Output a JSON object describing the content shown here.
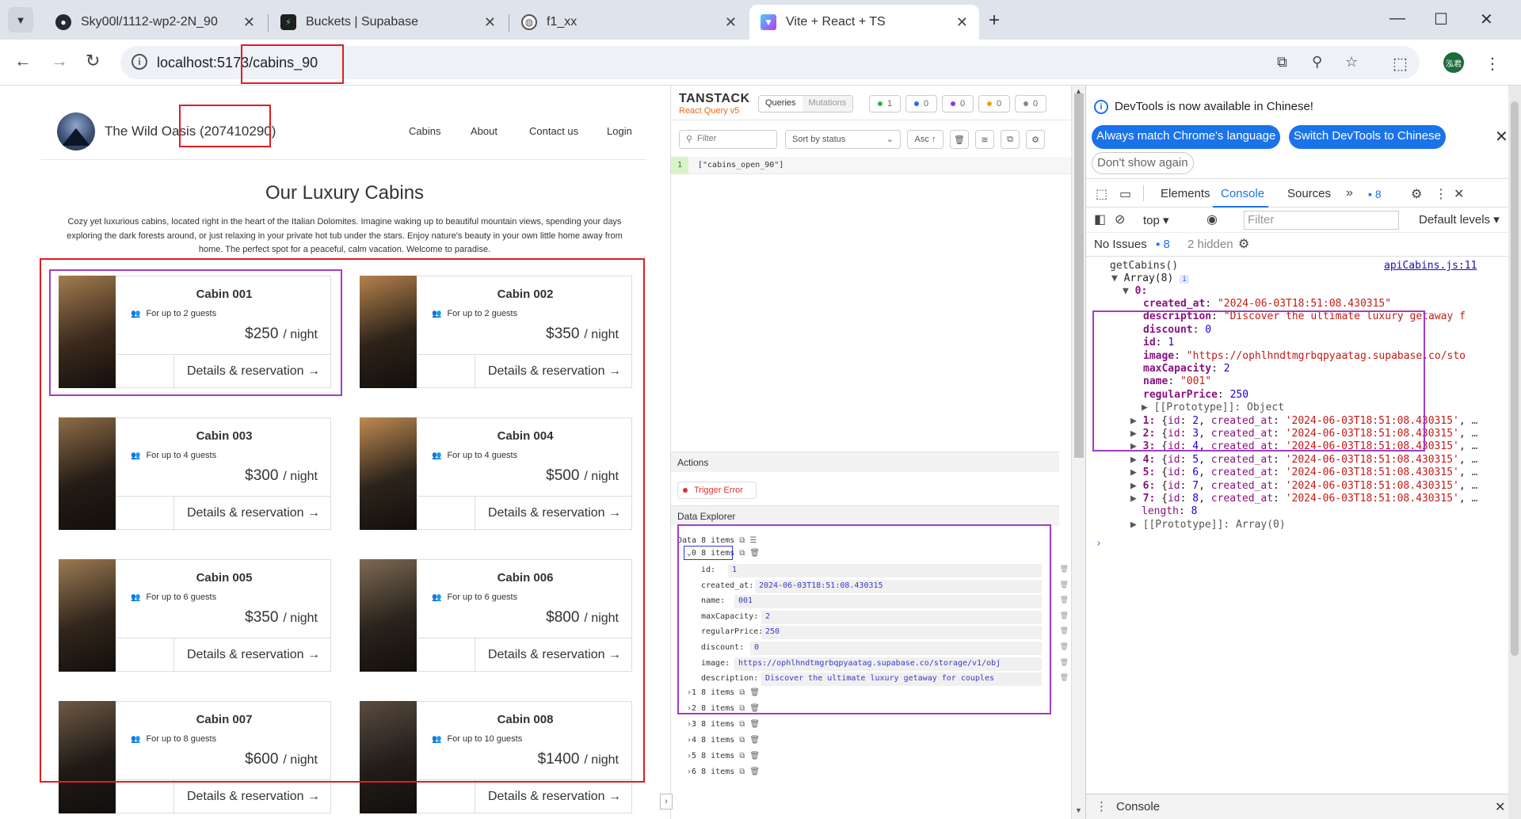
{
  "browser": {
    "tabs": [
      {
        "title": "Sky00l/1112-wp2-2N_90",
        "icon": "github-icon"
      },
      {
        "title": "Buckets | Supabase",
        "icon": "supabase-icon"
      },
      {
        "title": "f1_xx",
        "icon": "globe-icon"
      },
      {
        "title": "Vite + React + TS",
        "icon": "vite-icon"
      }
    ],
    "url": "localhost:5173/cabins_90",
    "avatar_text": "泓君"
  },
  "site": {
    "name": "The Wild Oasis (207410290)",
    "nav": [
      "Cabins",
      "About",
      "Contact us",
      "Login"
    ],
    "title": "Our Luxury Cabins",
    "description": "Cozy yet luxurious cabins, located right in the heart of the Italian Dolomites. Imagine waking up to beautiful mountain views, spending your days exploring the dark forests around, or just relaxing in your private hot tub under the stars. Enjoy nature's beauty in your own little home away from home. The perfect spot for a peaceful, calm vacation. Welcome to paradise.",
    "details_label": "Details & reservation →",
    "per_night": "/ night",
    "cabins": [
      {
        "name": "Cabin 001",
        "guests": "For up to 2 guests",
        "price": "$250"
      },
      {
        "name": "Cabin 002",
        "guests": "For up to 2 guests",
        "price": "$350"
      },
      {
        "name": "Cabin 003",
        "guests": "For up to 4 guests",
        "price": "$300"
      },
      {
        "name": "Cabin 004",
        "guests": "For up to 4 guests",
        "price": "$500"
      },
      {
        "name": "Cabin 005",
        "guests": "For up to 6 guests",
        "price": "$350"
      },
      {
        "name": "Cabin 006",
        "guests": "For up to 6 guests",
        "price": "$800"
      },
      {
        "name": "Cabin 007",
        "guests": "For up to 8 guests",
        "price": "$600"
      },
      {
        "name": "Cabin 008",
        "guests": "For up to 10 guests",
        "price": "$1400"
      }
    ]
  },
  "react_query": {
    "brand": "TANSTACK",
    "sub": "React Query v5",
    "tabs": [
      "Queries",
      "Mutations"
    ],
    "badges": [
      {
        "count": "1",
        "color": "#2fb344"
      },
      {
        "count": "0",
        "color": "#1a73e8"
      },
      {
        "count": "0",
        "color": "#7c3aed"
      },
      {
        "count": "0",
        "color": "#f59f00"
      },
      {
        "count": "0",
        "color": "#888888"
      }
    ],
    "filter_placeholder": "Filter",
    "sort": "Sort by status",
    "order": "Asc ↑",
    "query_count": "1",
    "query_key": "[\"cabins_open_90\"]",
    "actions_label": "Actions",
    "trigger_error": "Trigger Error",
    "explorer_label": "Data Explorer",
    "data_root": "Data",
    "data_root_count": "8 items",
    "items": [
      {
        "label": "0",
        "count": "8 items"
      },
      {
        "label": "1",
        "count": "8 items"
      },
      {
        "label": "2",
        "count": "8 items"
      },
      {
        "label": "3",
        "count": "8 items"
      },
      {
        "label": "4",
        "count": "8 items"
      },
      {
        "label": "5",
        "count": "8 items"
      },
      {
        "label": "6",
        "count": "8 items"
      }
    ],
    "fields": [
      {
        "key": "id:",
        "value": "1"
      },
      {
        "key": "created_at:",
        "value": "2024-06-03T18:51:08.430315"
      },
      {
        "key": "name:",
        "value": "001"
      },
      {
        "key": "maxCapacity:",
        "value": "2"
      },
      {
        "key": "regularPrice:",
        "value": "250"
      },
      {
        "key": "discount:",
        "value": "0"
      },
      {
        "key": "image:",
        "value": "https://ophlhndtmgrbqpyaatag.supabase.co/storage/v1/obj"
      },
      {
        "key": "description:",
        "value": "Discover the ultimate luxury getaway for couples"
      }
    ]
  },
  "devtools": {
    "banner": "DevTools is now available in Chinese!",
    "btn_match": "Always match Chrome's language",
    "btn_switch": "Switch DevTools to Chinese",
    "btn_dont": "Don't show again",
    "tabs": [
      "Elements",
      "Console",
      "Sources"
    ],
    "messages_count": "8",
    "context": "top",
    "filter_placeholder": "Filter",
    "levels": "Default levels",
    "no_issues": "No Issues",
    "issues_count": "8",
    "hidden": "2 hidden",
    "log_call": "getCabins()",
    "log_source": "apiCabins.js:11",
    "array_label": "Array(8)",
    "index0": "0:",
    "obj0": [
      {
        "key": "created_at",
        "value": "\"2024-06-03T18:51:08.430315\"",
        "type": "s"
      },
      {
        "key": "description",
        "value": "\"Discover the ultimate luxury getaway f",
        "type": "s"
      },
      {
        "key": "discount",
        "value": "0",
        "type": "n"
      },
      {
        "key": "id",
        "value": "1",
        "type": "n"
      },
      {
        "key": "image",
        "value": "\"https://ophlhndtmgrbqpyaatag.supabase.co/sto",
        "type": "s"
      },
      {
        "key": "maxCapacity",
        "value": "2",
        "type": "n"
      },
      {
        "key": "name",
        "value": "\"001\"",
        "type": "s"
      },
      {
        "key": "regularPrice",
        "value": "250",
        "type": "n"
      }
    ],
    "proto_obj": "[[Prototype]]: Object",
    "rows": [
      {
        "idx": "1:",
        "id": "2"
      },
      {
        "idx": "2:",
        "id": "3"
      },
      {
        "idx": "3:",
        "id": "4"
      },
      {
        "idx": "4:",
        "id": "5"
      },
      {
        "idx": "5:",
        "id": "6"
      },
      {
        "idx": "6:",
        "id": "7"
      },
      {
        "idx": "7:",
        "id": "8"
      }
    ],
    "row_created": "'2024-06-03T18:51:08.430315'",
    "length_key": "length",
    "length_val": "8",
    "proto_arr": "[[Prototype]]: Array(0)",
    "drawer": "Console"
  }
}
